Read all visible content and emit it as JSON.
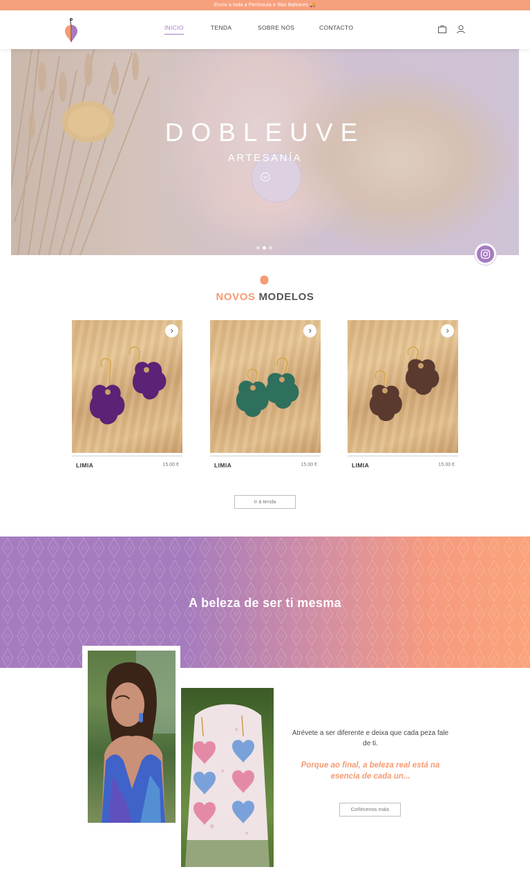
{
  "announcement": "Envío a toda a Península e Illas Baleares 🚚",
  "nav": {
    "items": [
      {
        "label": "INICIO",
        "active": true
      },
      {
        "label": "TENDA",
        "active": false
      },
      {
        "label": "SOBRE NÓS",
        "active": false
      },
      {
        "label": "CONTACTO",
        "active": false
      }
    ]
  },
  "header_icons": [
    "shopping-bag-icon",
    "user-icon"
  ],
  "hero": {
    "title": "DOBLEUVE",
    "subtitle": "ARTESANÍA",
    "slides_total": 3,
    "active_slide": 2
  },
  "novos": {
    "title_highlight": "NOVOS",
    "title_rest": "MODELOS",
    "products": [
      {
        "name": "LIMIA",
        "price": "15.00 €",
        "color": "#5b2276"
      },
      {
        "name": "LIMIA",
        "price": "15.00 €",
        "color": "#2f6f5d"
      },
      {
        "name": "LIMIA",
        "price": "15.00 €",
        "color": "#5a3a2f"
      }
    ],
    "button": "Ir á tenda"
  },
  "band": {
    "title_pre": "A",
    "title_bold": "beleza",
    "title_post": "de ser ti mesma"
  },
  "about": {
    "text": "Atrévete a ser diferente e deixa que cada peza fale de ti.",
    "quote": "Porque ao final, a beleza real está na esencia de cada un...",
    "button": "Coñécenos máis"
  },
  "colors": {
    "accent_purple": "#a57cc0",
    "accent_orange": "#f79a72",
    "announce_bg": "#f7a07d"
  }
}
